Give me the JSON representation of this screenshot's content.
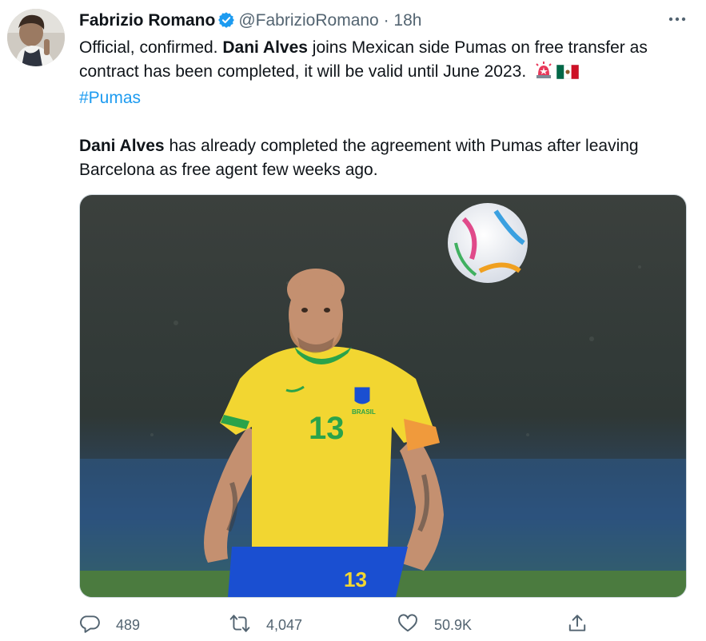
{
  "tweet": {
    "author_name": "Fabrizio Romano",
    "handle": "@FabrizioRomano",
    "separator": "·",
    "time": "18h",
    "line1_plain_a": "Official, confirmed. ",
    "line1_bold": "Dani Alves",
    "line1_plain_b": " joins Mexican side Pumas on free transfer as contract has been completed, it will be valid until June 2023.",
    "hashtag": "#Pumas",
    "para2_bold": "Dani Alves",
    "para2_plain": " has already completed the agreement with Pumas after leaving Barcelona as free agent few weeks ago.",
    "emojis": [
      "siren-emoji",
      "mexico-flag-emoji"
    ],
    "image": {
      "jersey_number": "13",
      "crest_text": "BRASIL"
    }
  },
  "actions": {
    "replies": "489",
    "retweets": "4,047",
    "likes": "50.9K"
  },
  "colors": {
    "link": "#1d9bf0",
    "secondary_text": "#536471",
    "verified": "#1d9bf0",
    "jersey_yellow": "#f2d631",
    "jersey_green": "#2aa34a",
    "shorts_blue": "#1a4fd1"
  }
}
